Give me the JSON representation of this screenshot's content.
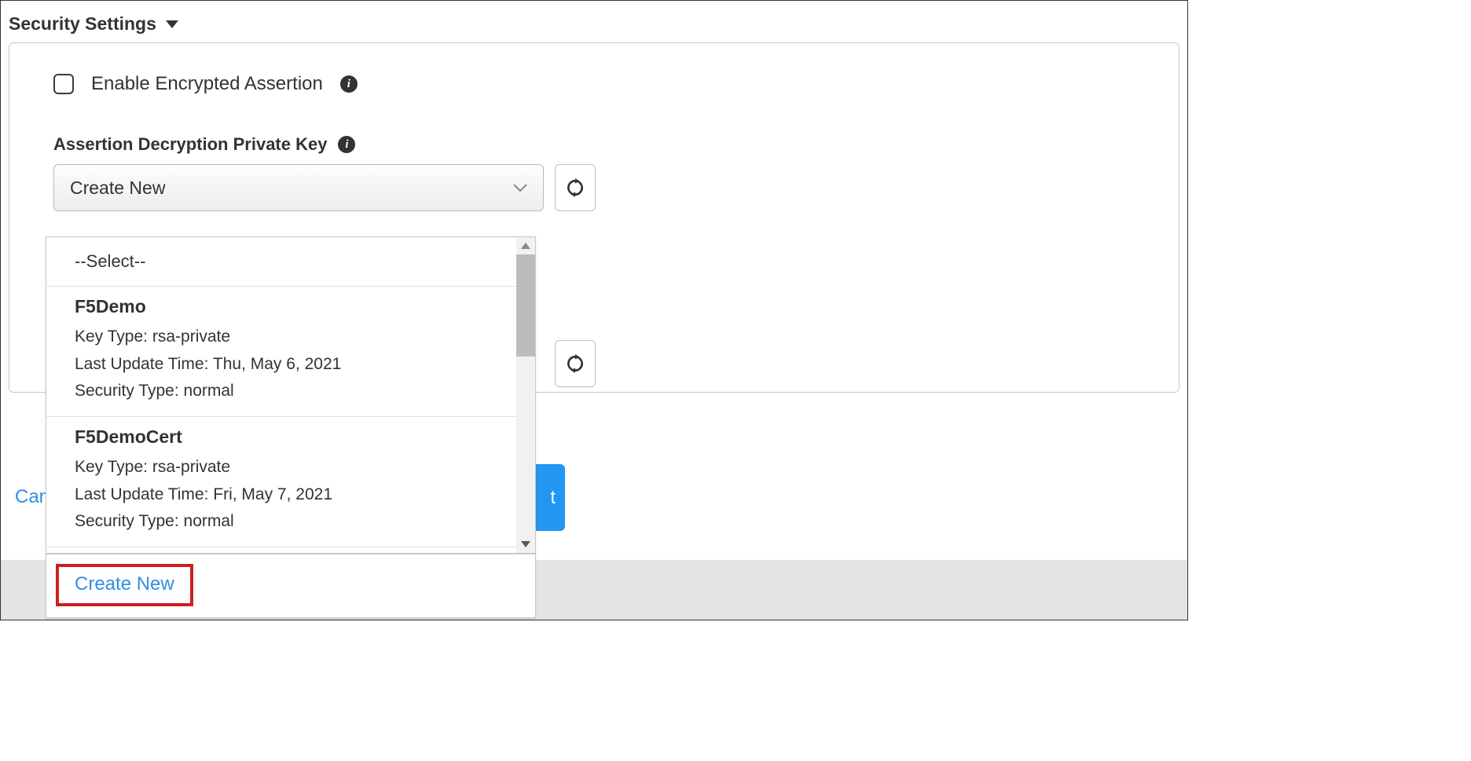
{
  "section": {
    "title": "Security Settings"
  },
  "checkbox": {
    "label": "Enable Encrypted Assertion"
  },
  "field": {
    "label": "Assertion Decryption Private Key",
    "selected": "Create New"
  },
  "dropdown": {
    "placeholder": "--Select--",
    "items": [
      {
        "name": "F5Demo",
        "keytype_label": "Key Type:",
        "keytype": "rsa-private",
        "updated_label": "Last Update Time:",
        "updated": "Thu, May 6, 2021",
        "sectype_label": "Security Type:",
        "sectype": "normal"
      },
      {
        "name": "F5DemoCert",
        "keytype_label": "Key Type:",
        "keytype": "rsa-private",
        "updated_label": "Last Update Time:",
        "updated": "Fri, May 7, 2021",
        "sectype_label": "Security Type:",
        "sectype": "normal"
      }
    ],
    "create_new": "Create New"
  },
  "footer": {
    "cancel": "Can",
    "next": "t"
  }
}
